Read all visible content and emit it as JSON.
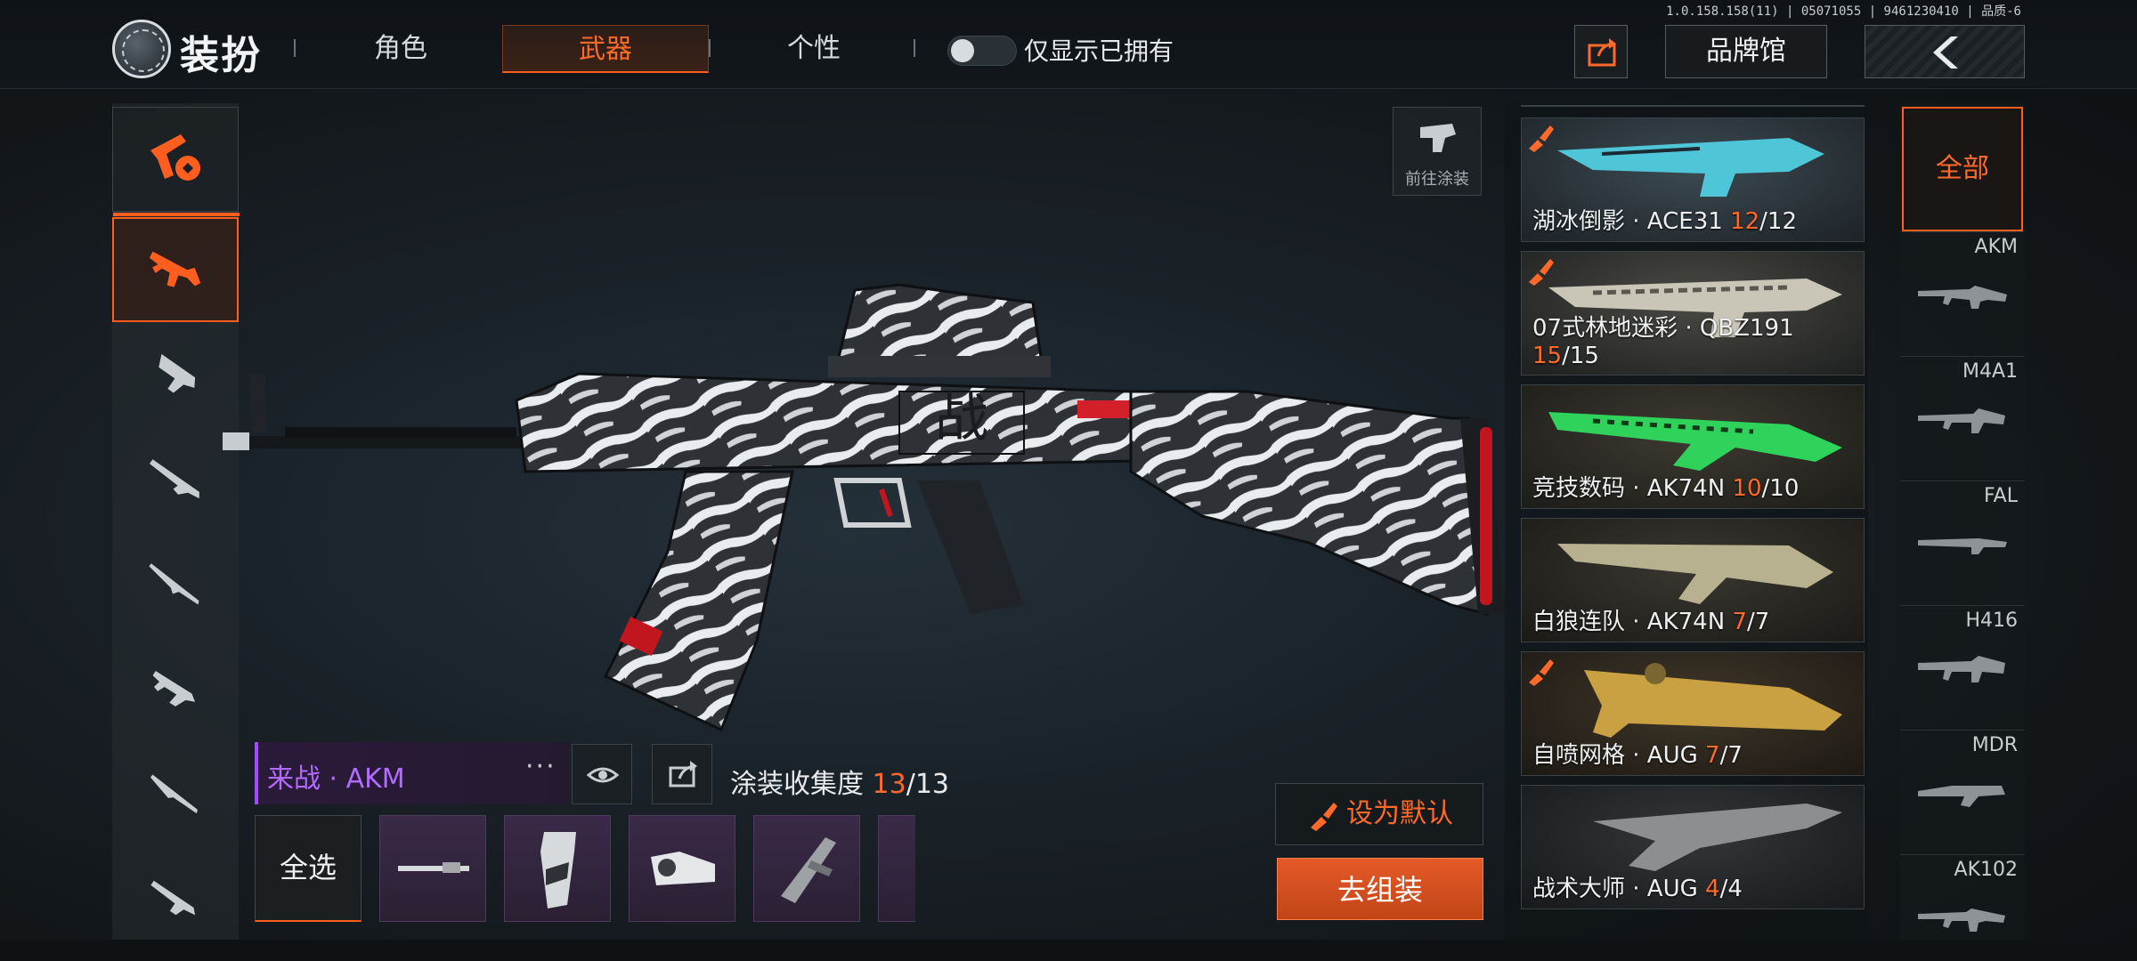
{
  "version": "1.0.158.158(11) | 05071055 | 9461230410 | 品质-6",
  "header": {
    "title": "装扮",
    "tabs": [
      {
        "label": "角色"
      },
      {
        "label": "武器"
      },
      {
        "label": "个性"
      }
    ],
    "active_tab": "武器",
    "toggle_label": "仅显示已拥有",
    "toggle_on": false,
    "brand_button": "品牌馆"
  },
  "preview": {
    "goto_paint_label": "前往涂装",
    "skin_name": "来战 · AKM",
    "more_label": "···",
    "collect_label": "涂装收集度",
    "collect_owned": "13",
    "collect_total": "/13",
    "select_all": "全选",
    "set_default": "设为默认",
    "assemble": "去组装"
  },
  "skins": [
    {
      "name": "湖冰倒影 · ACE31",
      "owned": "12",
      "total": "/12",
      "color": "#4fc6d8"
    },
    {
      "name": "07式林地迷彩 · QBZ191",
      "owned": "15",
      "total": "/15",
      "color": "#c9c6b8"
    },
    {
      "name": "竞技数码 · AK74N",
      "owned": "10",
      "total": "/10",
      "color": "#2fd25a"
    },
    {
      "name": "白狼连队 · AK74N",
      "owned": "7",
      "total": "/7",
      "color": "#b7b190"
    },
    {
      "name": "自喷网格 · AUG",
      "owned": "7",
      "total": "/7",
      "color": "#c9a042"
    },
    {
      "name": "战术大师 · AUG",
      "owned": "4",
      "total": "/4",
      "color": "#8b8f92"
    }
  ],
  "weapons": {
    "all_label": "全部",
    "items": [
      "AKM",
      "M4A1",
      "FAL",
      "H416",
      "MDR",
      "AK102"
    ]
  },
  "colors": {
    "accent": "#ff5e1f",
    "purple": "#a24cff"
  }
}
